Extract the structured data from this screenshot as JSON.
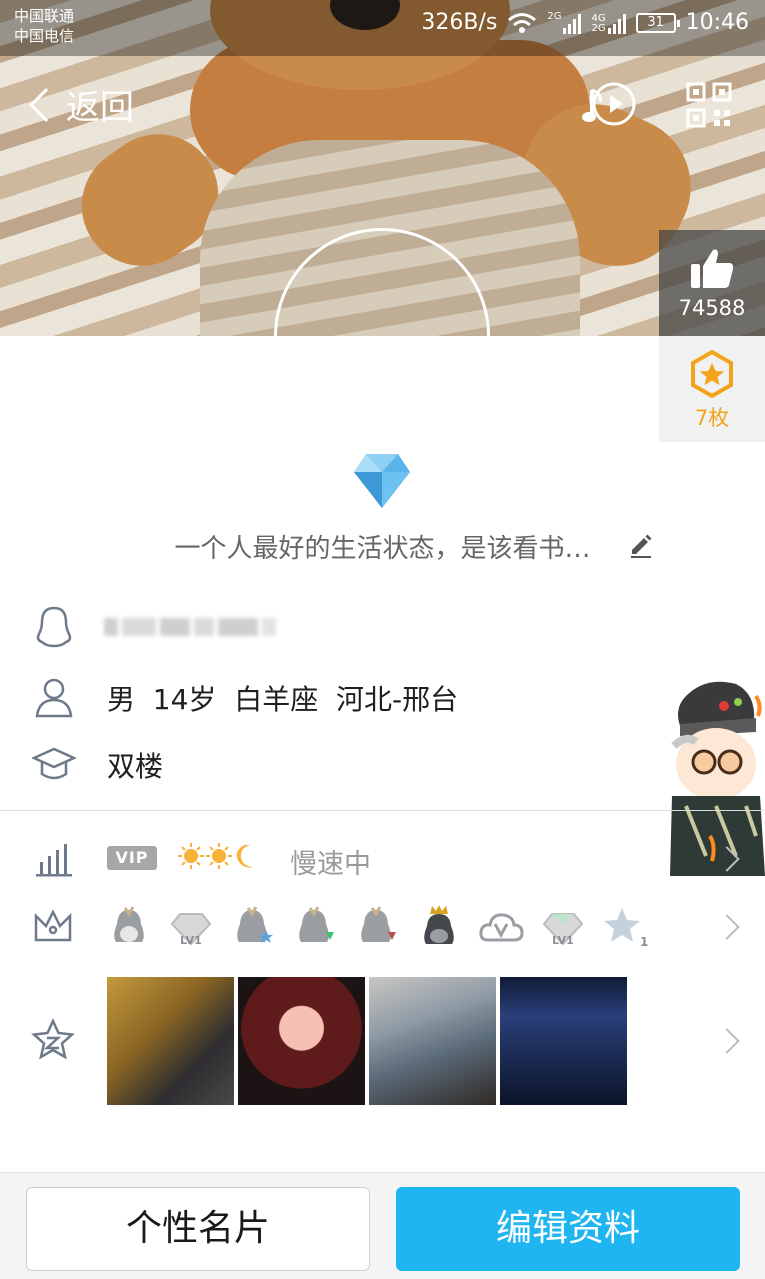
{
  "status_bar": {
    "carrier_1": "中国联通",
    "carrier_2": "中国电信",
    "net_speed": "326B/s",
    "signal_1_label": "2G",
    "signal_2_label_top": "4G",
    "signal_2_label_bottom": "2G",
    "battery": "31",
    "time": "10:46"
  },
  "nav": {
    "back_label": "返回",
    "icons": [
      "music-play-icon",
      "qr-code-icon"
    ]
  },
  "profile": {
    "likes": "74588",
    "medals": "7枚",
    "signature": "一个人最好的生活状态，是该看书…",
    "basic_info": "男  14岁  白羊座  河北-邢台",
    "school": "双楼"
  },
  "level_row": {
    "vip": "VIP",
    "status": "慢速中"
  },
  "badges_row": {
    "icons": [
      "penguin-badge-icon",
      "diamond-lv1-badge-icon",
      "penguin-star-badge-icon",
      "penguin-green-badge-icon",
      "penguin-red-badge-icon",
      "penguin-crown-badge-icon",
      "cloud-v-badge-icon",
      "diamond-lv1-badge-icon",
      "star-1-badge-icon"
    ],
    "badge_labels": {
      "lv1": "LV1",
      "star_count": "1"
    }
  },
  "bottom_bar": {
    "card_label": "个性名片",
    "edit_label": "编辑资料"
  },
  "colors": {
    "accent": "#1fb5f0",
    "medal": "#f2a31a",
    "diamond": "#4aa8e0"
  }
}
